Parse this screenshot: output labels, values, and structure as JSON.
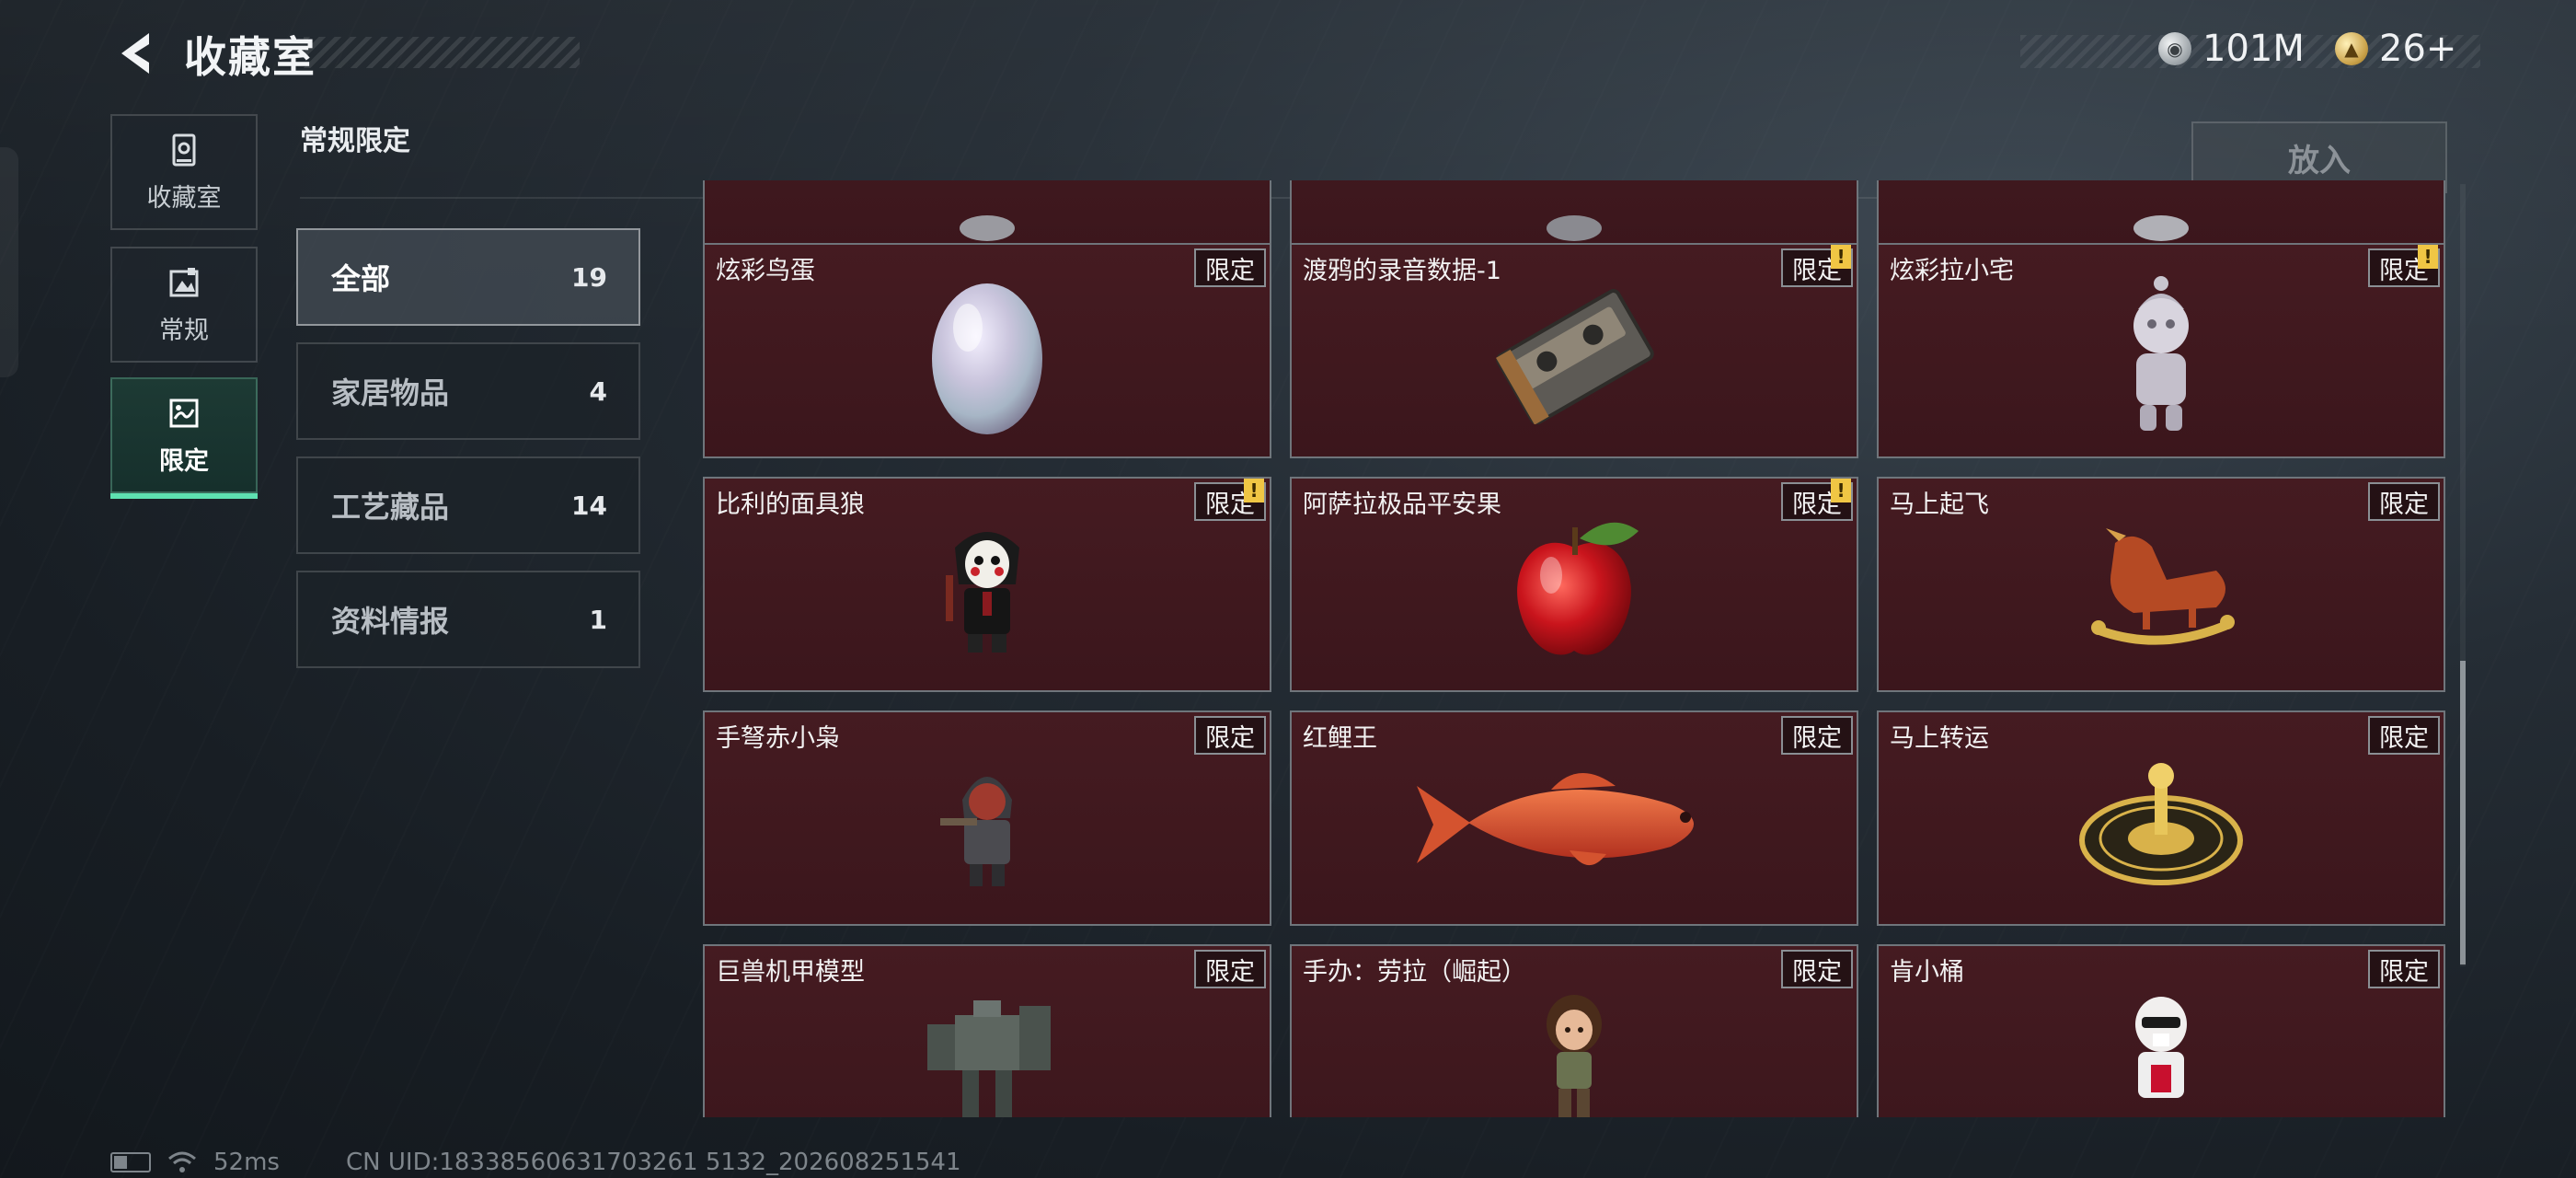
{
  "header": {
    "title": "收藏室",
    "currencies": [
      {
        "icon": "silver-coin-icon",
        "value": "101M"
      },
      {
        "icon": "gold-coin-icon",
        "value": "26+"
      }
    ]
  },
  "side_nav": [
    {
      "label": "收藏室",
      "icon": "vault-icon",
      "active": false
    },
    {
      "label": "常规",
      "icon": "regular-collection-icon",
      "active": false
    },
    {
      "label": "限定",
      "icon": "limited-collection-icon",
      "active": true
    }
  ],
  "section": {
    "title": "常规限定"
  },
  "filters": [
    {
      "label": "全部",
      "count": "19",
      "active": true
    },
    {
      "label": "家居物品",
      "count": "4",
      "active": false
    },
    {
      "label": "工艺藏品",
      "count": "14",
      "active": false
    },
    {
      "label": "资料情报",
      "count": "1",
      "active": false
    }
  ],
  "put_in_button": "放入",
  "items": [
    {
      "name": "",
      "badge": "",
      "alert": false,
      "icon": "partial-item-icon"
    },
    {
      "name": "",
      "badge": "",
      "alert": false,
      "icon": "partial-item-icon"
    },
    {
      "name": "",
      "badge": "",
      "alert": false,
      "icon": "partial-item-icon"
    },
    {
      "name": "炫彩鸟蛋",
      "badge": "限定",
      "alert": false,
      "icon": "iridescent-egg-icon"
    },
    {
      "name": "渡鸦的录音数据-1",
      "badge": "限定",
      "alert": true,
      "icon": "cassette-tape-icon"
    },
    {
      "name": "炫彩拉小宅",
      "badge": "限定",
      "alert": true,
      "icon": "silver-doll-icon"
    },
    {
      "name": "比利的面具狼",
      "badge": "限定",
      "alert": true,
      "icon": "masked-figure-icon"
    },
    {
      "name": "阿萨拉极品平安果",
      "badge": "限定",
      "alert": true,
      "icon": "red-apple-icon"
    },
    {
      "name": "马上起飞",
      "badge": "限定",
      "alert": false,
      "icon": "rocking-horse-icon"
    },
    {
      "name": "手弩赤小枭",
      "badge": "限定",
      "alert": false,
      "icon": "hooded-figure-icon"
    },
    {
      "name": "红鲤王",
      "badge": "限定",
      "alert": false,
      "icon": "red-carp-icon"
    },
    {
      "name": "马上转运",
      "badge": "限定",
      "alert": false,
      "icon": "gold-compass-icon"
    },
    {
      "name": "巨兽机甲模型",
      "badge": "限定",
      "alert": false,
      "icon": "mech-model-icon"
    },
    {
      "name": "手办：劳拉（崛起）",
      "badge": "限定",
      "alert": false,
      "icon": "lara-figure-icon"
    },
    {
      "name": "肯小桶",
      "badge": "限定",
      "alert": false,
      "icon": "colonel-figure-icon"
    }
  ],
  "status_bar": {
    "ping": "52ms",
    "uid": "CN UID:18338560631703261 5132_202608251541"
  },
  "colors": {
    "card_bg": "#3f181d",
    "active_accent": "#5ee0b0",
    "alert": "#f0c644"
  }
}
